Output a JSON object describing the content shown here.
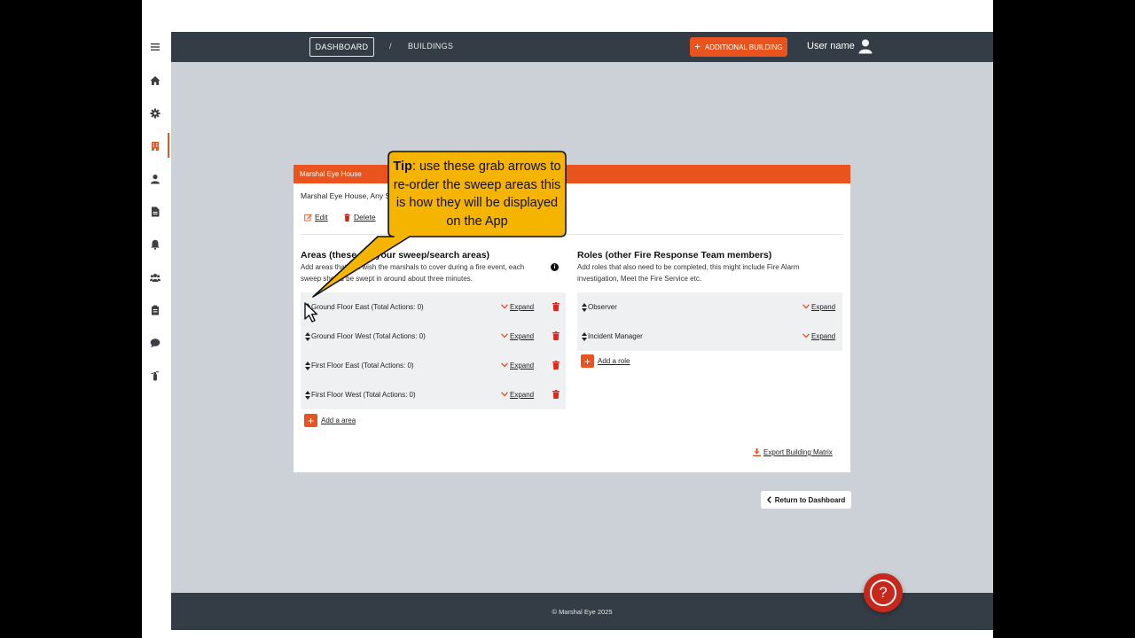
{
  "topbar": {
    "dashboard_label": "DASHBOARD",
    "breadcrumb_separator": "/",
    "buildings_label": "BUILDINGS",
    "additional_building_label": "ADDITIONAL BUILDING",
    "user_name": "User name"
  },
  "sidebar": {
    "items": [
      {
        "icon": "menu-icon"
      },
      {
        "icon": "home-icon"
      },
      {
        "icon": "gear-icon"
      },
      {
        "icon": "building-icon",
        "active": true
      },
      {
        "icon": "user-icon"
      },
      {
        "icon": "document-icon"
      },
      {
        "icon": "bell-icon"
      },
      {
        "icon": "team-icon"
      },
      {
        "icon": "clipboard-icon"
      },
      {
        "icon": "chat-icon"
      },
      {
        "icon": "extinguisher-icon"
      }
    ]
  },
  "building": {
    "name": "Marshal Eye House",
    "address": "Marshal Eye House, Any St",
    "edit_label": "Edit",
    "delete_label": "Delete"
  },
  "areas": {
    "title": "Areas (these are your sweep/search areas)",
    "description": "Add areas that you wish the marshals to cover during a fire event, each sweep should be swept in around about three minutes.",
    "items": [
      {
        "label": "Ground Floor East (Total Actions: 0)",
        "expand": "Expand"
      },
      {
        "label": "Ground Floor West (Total Actions: 0)",
        "expand": "Expand"
      },
      {
        "label": "First Floor East (Total Actions: 0)",
        "expand": "Expand"
      },
      {
        "label": "First Floor West (Total Actions: 0)",
        "expand": "Expand"
      }
    ],
    "add_label": "Add a area"
  },
  "roles": {
    "title": "Roles (other Fire Response Team members)",
    "description": "Add roles that also need to be completed, this might include Fire Alarm investigation, Meet the Fire Service etc.",
    "items": [
      {
        "label": "Observer",
        "expand": "Expand"
      },
      {
        "label": "Incident Manager",
        "expand": "Expand"
      }
    ],
    "add_label": "Add a role"
  },
  "export_label": "Export Building Matrix",
  "return_label": "Return to Dashboard",
  "footer_text": "© Marshal Eye 2025",
  "tip": {
    "lead": "Tip",
    "text": ": use these grab arrows to re-order the sweep areas this is how they will be displayed on the App"
  },
  "colors": {
    "accent": "#e9531e",
    "topbar": "#343d46",
    "content_bg": "#cbd1d6",
    "tip_bg": "#f5b400"
  }
}
